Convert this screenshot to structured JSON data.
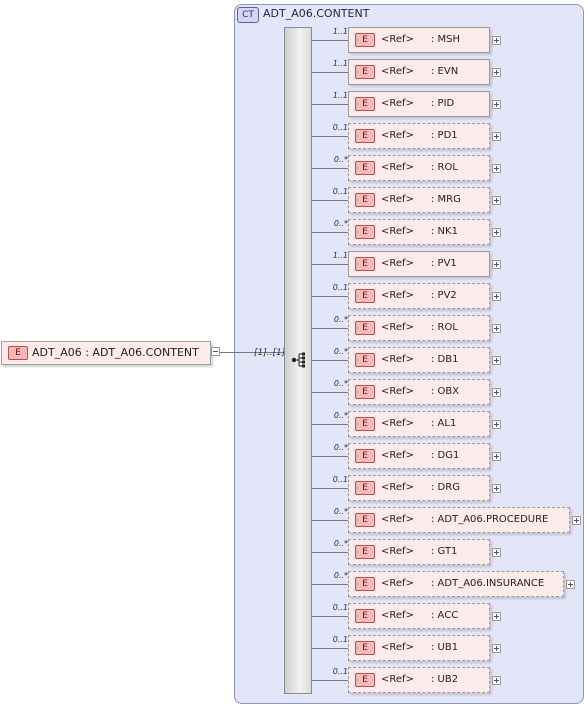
{
  "root": {
    "badge": "E",
    "label": "ADT_A06 : ADT_A06.CONTENT",
    "cardinality": "[1]..[1]"
  },
  "complex_type": {
    "badge": "CT",
    "title": "ADT_A06.CONTENT"
  },
  "sequence_icon": "sequence-compositor-icon",
  "elements": [
    {
      "card": "1..1",
      "badge": "E",
      "ref": "<Ref>",
      "name": ": MSH",
      "optional": false
    },
    {
      "card": "1..1",
      "badge": "E",
      "ref": "<Ref>",
      "name": ": EVN",
      "optional": false
    },
    {
      "card": "1..1",
      "badge": "E",
      "ref": "<Ref>",
      "name": ": PID",
      "optional": false
    },
    {
      "card": "0..1",
      "badge": "E",
      "ref": "<Ref>",
      "name": ": PD1",
      "optional": true
    },
    {
      "card": "0..*",
      "badge": "E",
      "ref": "<Ref>",
      "name": ": ROL",
      "optional": true
    },
    {
      "card": "0..1",
      "badge": "E",
      "ref": "<Ref>",
      "name": ": MRG",
      "optional": true
    },
    {
      "card": "0..*",
      "badge": "E",
      "ref": "<Ref>",
      "name": ": NK1",
      "optional": true
    },
    {
      "card": "1..1",
      "badge": "E",
      "ref": "<Ref>",
      "name": ": PV1",
      "optional": false
    },
    {
      "card": "0..1",
      "badge": "E",
      "ref": "<Ref>",
      "name": ": PV2",
      "optional": true
    },
    {
      "card": "0..*",
      "badge": "E",
      "ref": "<Ref>",
      "name": ": ROL",
      "optional": true
    },
    {
      "card": "0..*",
      "badge": "E",
      "ref": "<Ref>",
      "name": ": DB1",
      "optional": true
    },
    {
      "card": "0..*",
      "badge": "E",
      "ref": "<Ref>",
      "name": ": OBX",
      "optional": true
    },
    {
      "card": "0..*",
      "badge": "E",
      "ref": "<Ref>",
      "name": ": AL1",
      "optional": true
    },
    {
      "card": "0..*",
      "badge": "E",
      "ref": "<Ref>",
      "name": ": DG1",
      "optional": true
    },
    {
      "card": "0..1",
      "badge": "E",
      "ref": "<Ref>",
      "name": ": DRG",
      "optional": true
    },
    {
      "card": "0..*",
      "badge": "E",
      "ref": "<Ref>",
      "name": ": ADT_A06.PROCEDURE",
      "optional": true
    },
    {
      "card": "0..*",
      "badge": "E",
      "ref": "<Ref>",
      "name": ": GT1",
      "optional": true
    },
    {
      "card": "0..*",
      "badge": "E",
      "ref": "<Ref>",
      "name": ": ADT_A06.INSURANCE",
      "optional": true
    },
    {
      "card": "0..1",
      "badge": "E",
      "ref": "<Ref>",
      "name": ": ACC",
      "optional": true
    },
    {
      "card": "0..1",
      "badge": "E",
      "ref": "<Ref>",
      "name": ": UB1",
      "optional": true
    },
    {
      "card": "0..1",
      "badge": "E",
      "ref": "<Ref>",
      "name": ": UB2",
      "optional": true
    }
  ]
}
